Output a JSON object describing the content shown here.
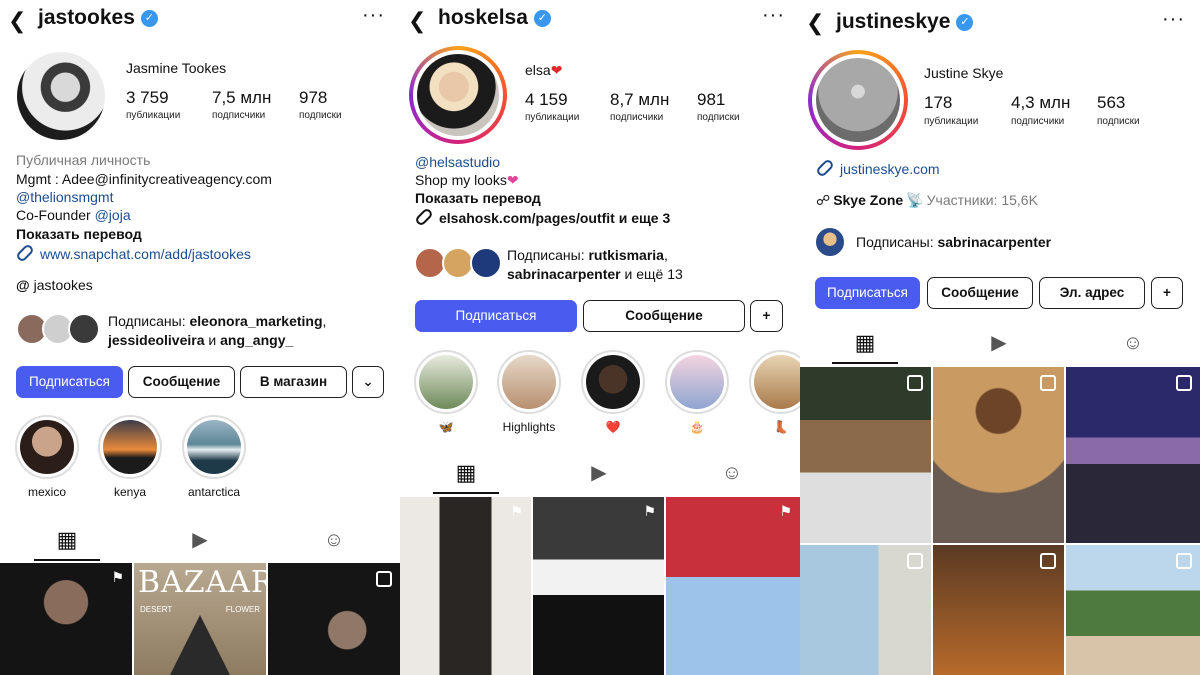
{
  "panels": [
    {
      "username": "jastookes",
      "fullname": "Jasmine Tookes",
      "stats": [
        {
          "num": "3 759",
          "label": "публикации"
        },
        {
          "num": "7,5 млн",
          "label": "подписчики"
        },
        {
          "num": "978",
          "label": "подписки"
        }
      ],
      "bio": {
        "category": "Публичная личность",
        "line1": "Mgmt : Adee@infinitycreativeagency.com",
        "line2": "@thelionsmgmt",
        "line3_prefix": "Co-Founder ",
        "line3_link": "@joja",
        "translate": "Показать перевод",
        "website": "www.snapchat.com/add/jastookes",
        "threads": "jastookes"
      },
      "followed_prefix": "Подписаны: ",
      "followed_names1": "eleonora_marketing",
      "followed_sep1": ",",
      "followed_names2": "jessideoliveira",
      "followed_and": " и ",
      "followed_names3": "ang_angy_",
      "buttons": {
        "follow": "Подписаться",
        "message": "Сообщение",
        "shop": "В магазин"
      },
      "highlights": [
        "mexico",
        "kenya",
        "antarctica"
      ]
    },
    {
      "username": "hoskelsa",
      "fullname": "elsa",
      "stats": [
        {
          "num": "4 159",
          "label": "публикации"
        },
        {
          "num": "8,7 млн",
          "label": "подписчики"
        },
        {
          "num": "981",
          "label": "подписки"
        }
      ],
      "bio": {
        "line1": "@helsastudio",
        "line2": "Shop my looks",
        "translate": "Показать перевод",
        "website": "elsahosk.com/pages/outfit и еще 3"
      },
      "followed_prefix": "Подписаны: ",
      "followed_names1": "rutkismaria",
      "followed_sep1": ",",
      "followed_names2": "sabrinacarpenter",
      "followed_and": " и ещё 13",
      "buttons": {
        "follow": "Подписаться",
        "message": "Сообщение"
      },
      "highlights": [
        "🦋",
        "Highlights",
        "❤️",
        "🎂",
        "👢"
      ]
    },
    {
      "username": "justineskye",
      "fullname": "Justine Skye",
      "stats": [
        {
          "num": "178",
          "label": "публикации"
        },
        {
          "num": "4,3 млн",
          "label": "подписчики"
        },
        {
          "num": "563",
          "label": "подписки"
        }
      ],
      "bio": {
        "website": "justineskye.com",
        "zone_name": "Skye Zone",
        "zone_members": "Участники: 15,6K"
      },
      "followed_prefix": "Подписаны: ",
      "followed_names1": "sabrinacarpenter",
      "buttons": {
        "follow": "Подписаться",
        "message": "Сообщение",
        "email": "Эл. адрес"
      }
    }
  ],
  "grid_images": {
    "p1": [
      "portrait-woman-necklace",
      "bazaar-arabia-cover",
      "woman-night-dress"
    ],
    "p2": [
      "model-black-suit-chair",
      "model-black-white-gown",
      "model-blue-tulle-gown"
    ],
    "p3": [
      "woman-white-top-sofa",
      "woman-mirror-selfie",
      "recording-studio",
      "city-window-view",
      "woman-orange-dress",
      "bikini-beach-cliff"
    ]
  },
  "grid_labels": {
    "bazaar_title": "BAZAAR",
    "bazaar_left": "DESERT",
    "bazaar_right": "FLOWER"
  },
  "colors": {
    "primary_button": "#4a5cf0",
    "verified": "#3897f0",
    "link": "#1c4d8f"
  }
}
